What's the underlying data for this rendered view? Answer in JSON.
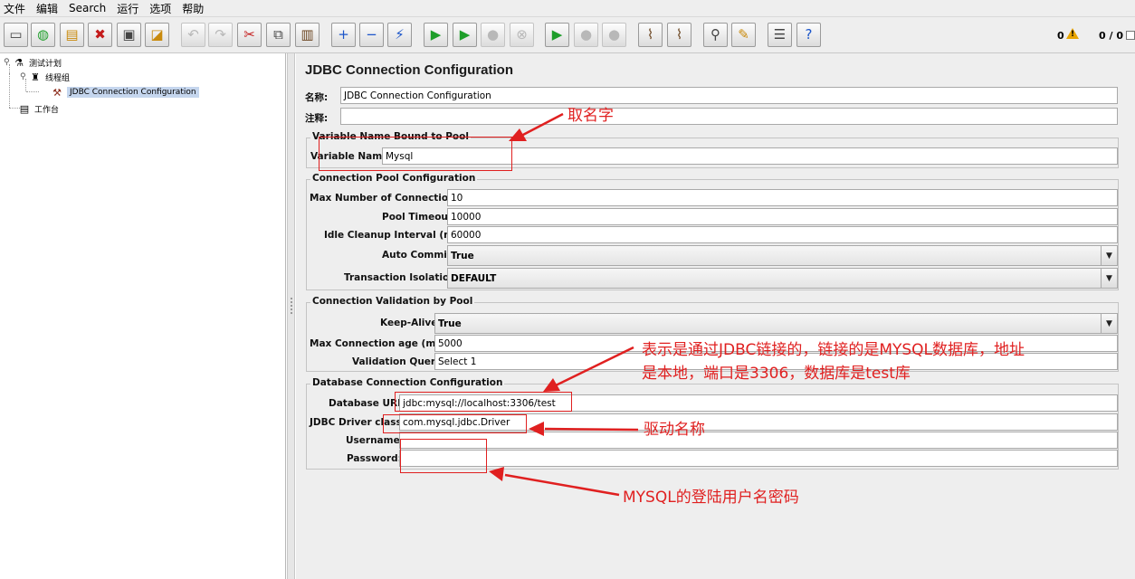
{
  "menu": [
    "文件",
    "编辑",
    "Search",
    "运行",
    "选项",
    "帮助"
  ],
  "toolbar": {
    "buttons": [
      {
        "name": "new-icon",
        "glyph": "▭"
      },
      {
        "name": "templates-icon",
        "glyph": "◍"
      },
      {
        "name": "open-icon",
        "glyph": "▤"
      },
      {
        "name": "close-icon",
        "glyph": "✖"
      },
      {
        "name": "save-icon",
        "glyph": "▣"
      },
      {
        "name": "save-screenshot-icon",
        "glyph": "◪"
      },
      {
        "name": "undo-icon",
        "glyph": "↶"
      },
      {
        "name": "redo-icon",
        "glyph": "↷"
      },
      {
        "name": "cut-icon",
        "glyph": "✂"
      },
      {
        "name": "copy-icon",
        "glyph": "⧉"
      },
      {
        "name": "paste-icon",
        "glyph": "▥"
      },
      {
        "name": "expand-icon",
        "glyph": "+"
      },
      {
        "name": "collapse-icon",
        "glyph": "−"
      },
      {
        "name": "toggle-icon",
        "glyph": "⚡"
      },
      {
        "name": "start-icon",
        "glyph": "▶"
      },
      {
        "name": "start-no-pauses-icon",
        "glyph": "▶"
      },
      {
        "name": "stop-icon",
        "glyph": "●"
      },
      {
        "name": "shutdown-icon",
        "glyph": "⊗"
      },
      {
        "name": "remote-start-icon",
        "glyph": "▶"
      },
      {
        "name": "remote-stop-icon",
        "glyph": "●"
      },
      {
        "name": "remote-exit-icon",
        "glyph": "●"
      },
      {
        "name": "clear-icon",
        "glyph": "⌇"
      },
      {
        "name": "clear-all-icon",
        "glyph": "⌇"
      },
      {
        "name": "search-icon",
        "glyph": "⚲"
      },
      {
        "name": "reset-search-icon",
        "glyph": "✎"
      },
      {
        "name": "function-helper-icon",
        "glyph": "☰"
      },
      {
        "name": "help-icon",
        "glyph": "?"
      }
    ],
    "warnings": "0",
    "threads": "0 / 0"
  },
  "tree": {
    "items": [
      {
        "label": "测试计划"
      },
      {
        "label": "线程组"
      },
      {
        "label": "JDBC Connection Configuration"
      },
      {
        "label": "工作台"
      }
    ]
  },
  "panel": {
    "title": "JDBC Connection Configuration",
    "name_label": "名称:",
    "name_value": "JDBC Connection Configuration",
    "comment_label": "注释:",
    "comment_value": "",
    "var_group": "Variable Name Bound to Pool",
    "var_label": "Variable Name:",
    "var_value": "Mysql",
    "pool_group": "Connection Pool Configuration",
    "max_conn_label": "Max Number of Connections:",
    "max_conn_value": "10",
    "pool_timeout_label": "Pool Timeout:",
    "pool_timeout_value": "10000",
    "idle_label": "Idle Cleanup Interval (ms):",
    "idle_value": "60000",
    "auto_commit_label": "Auto Commit:",
    "auto_commit_value": "True",
    "isolation_label": "Transaction Isolation:",
    "isolation_value": "DEFAULT",
    "validation_group": "Connection Validation by Pool",
    "keepalive_label": "Keep-Alive:",
    "keepalive_value": "True",
    "maxage_label": "Max Connection age (ms):",
    "maxage_value": "5000",
    "query_label": "Validation Query:",
    "query_value": "Select 1",
    "db_group": "Database Connection Configuration",
    "url_label": "Database URL:",
    "url_value": "jdbc:mysql://localhost:3306/test",
    "driver_label": "JDBC Driver class:",
    "driver_value": "com.mysql.jdbc.Driver",
    "user_label": "Username:",
    "user_value": "",
    "pass_label": "Password:",
    "pass_value": ""
  },
  "annotations": {
    "name_note": "取名字",
    "url_note_1": "表示是通过JDBC链接的，链接的是MYSQL数据库，地址",
    "url_note_2": "是本地，端口是3306，数据库是test库",
    "driver_note": "驱动名称",
    "login_note": "MYSQL的登陆用户名密码",
    "color": "#e02020"
  }
}
